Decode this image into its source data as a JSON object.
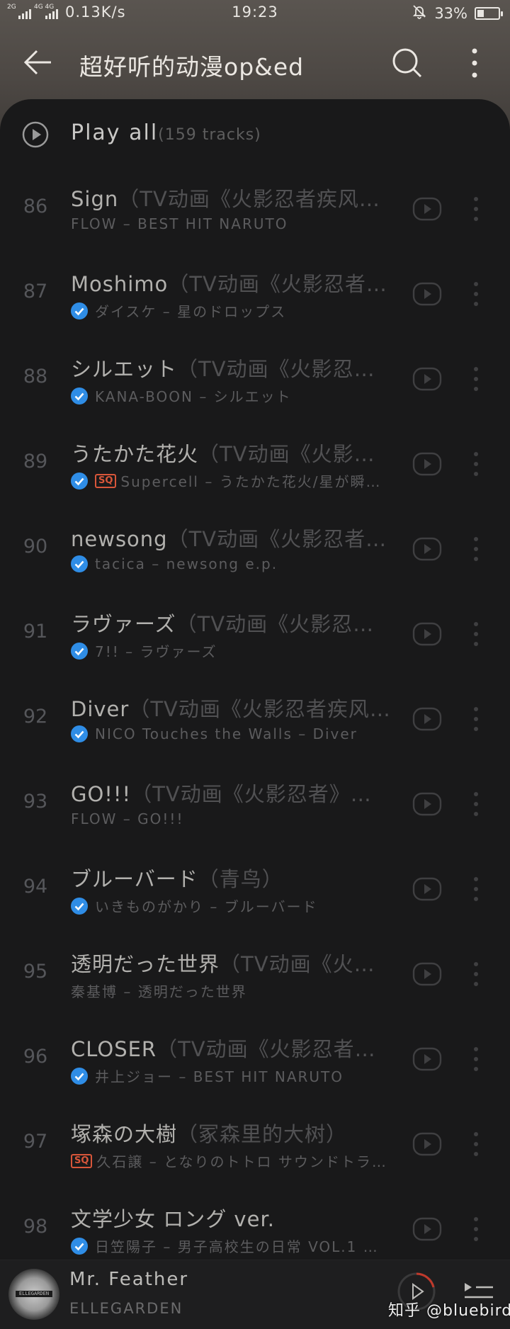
{
  "status_bar": {
    "signal1_label": "2G",
    "signal2_label": "4G 4G",
    "net_speed": "0.13K/s",
    "time": "19:23",
    "battery_percent": "33%",
    "battery_level": 0.33,
    "icons": [
      "signal-icon",
      "signal-icon",
      "bell-muted-icon",
      "battery-icon"
    ]
  },
  "header": {
    "title": "超好听的动漫op&ed",
    "icons": [
      "back-arrow-icon",
      "search-icon",
      "more-vertical-icon"
    ]
  },
  "play_all": {
    "label": "Play  all",
    "count": "(159 tracks)"
  },
  "tracks": [
    {
      "num": "86",
      "title": "Sign",
      "subtitle": "（TV动画《火影忍者疾风…",
      "meta": "FLOW – BEST HIT NARUTO",
      "verified": false,
      "sq": false
    },
    {
      "num": "87",
      "title": "Moshimo",
      "subtitle": "（TV动画《火影忍者…",
      "meta": "ダイスケ – 星のドロップス",
      "verified": true,
      "sq": false
    },
    {
      "num": "88",
      "title": "シルエット",
      "subtitle": "（TV动画《火影忍…",
      "meta": "KANA-BOON – シルエット",
      "verified": true,
      "sq": false
    },
    {
      "num": "89",
      "title": "うたかた花火",
      "subtitle": "（TV动画《火影…",
      "meta": "Supercell – うたかた花火/星が瞬…",
      "verified": true,
      "sq": true
    },
    {
      "num": "90",
      "title": "newsong",
      "subtitle": "（TV动画《火影忍者…",
      "meta": "tacica – newsong e.p.",
      "verified": true,
      "sq": false
    },
    {
      "num": "91",
      "title": "ラヴァーズ",
      "subtitle": "（TV动画《火影忍…",
      "meta": "7!! – ラヴァーズ",
      "verified": true,
      "sq": false
    },
    {
      "num": "92",
      "title": "Diver",
      "subtitle": "（TV动画《火影忍者疾风…",
      "meta": "NICO Touches the Walls – Diver",
      "verified": true,
      "sq": false
    },
    {
      "num": "93",
      "title": "GO!!!",
      "subtitle": "（TV动画《火影忍者》…",
      "meta": "FLOW – GO!!!",
      "verified": false,
      "sq": false
    },
    {
      "num": "94",
      "title": "ブルーバード",
      "subtitle": "（青鸟）",
      "meta": "いきものがかり – ブルーバード",
      "verified": true,
      "sq": false
    },
    {
      "num": "95",
      "title": "透明だった世界",
      "subtitle": "（TV动画《火…",
      "meta": "秦基博 – 透明だった世界",
      "verified": false,
      "sq": false
    },
    {
      "num": "96",
      "title": "CLOSER",
      "subtitle": "（TV动画《火影忍者…",
      "meta": "井上ジョー – BEST HIT NARUTO",
      "verified": true,
      "sq": false
    },
    {
      "num": "97",
      "title": "塚森の大樹",
      "subtitle": "（冢森里的大树）",
      "meta": "久石譲 – となりのトトロ サウンドトラ…",
      "verified": false,
      "sq": true
    },
    {
      "num": "98",
      "title": "文学少女 ロング ver.",
      "subtitle": "",
      "meta": "日笠陽子 – 男子高校生の日常 VOL.1 …",
      "verified": true,
      "sq": false
    }
  ],
  "sq_badge_label": "SQ",
  "row_icons": [
    "play-circle-icon",
    "more-vertical-icon"
  ],
  "player": {
    "title": "Mr. Feather",
    "artist": "ELLEGARDEN",
    "album_art_text": "ELLEGARDEN",
    "icons": [
      "play-icon",
      "queue-icon"
    ]
  },
  "watermark": "知乎 @bluebird",
  "colors": {
    "header": "#4d4844",
    "panel": "#19191a",
    "verified_blue": "#2f8de6",
    "sq_red": "#d8563a",
    "player_ring_red": "#c0392b"
  }
}
